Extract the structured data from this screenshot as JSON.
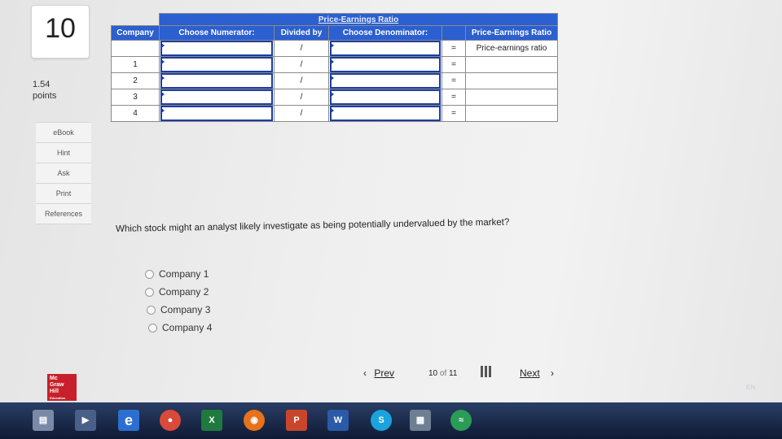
{
  "question_number": "10",
  "points": {
    "value": "1.54",
    "label": "points"
  },
  "side_tools": [
    "eBook",
    "Hint",
    "Ask",
    "Print",
    "References"
  ],
  "table": {
    "title": "Price-Earnings Ratio",
    "headers": {
      "company": "Company",
      "numerator": "Choose Numerator:",
      "divided_by": "Divided by",
      "denominator": "Choose Denominator:",
      "ratio": "Price-Earnings Ratio"
    },
    "formula_row": {
      "divide": "/",
      "equals": "=",
      "result": "Price-earnings ratio"
    },
    "rows": [
      {
        "company": "1",
        "divide": "/",
        "equals": "="
      },
      {
        "company": "2",
        "divide": "/",
        "equals": "="
      },
      {
        "company": "3",
        "divide": "/",
        "equals": "="
      },
      {
        "company": "4",
        "divide": "/",
        "equals": "="
      }
    ]
  },
  "question": "Which stock might an analyst likely investigate as being potentially undervalued by the market?",
  "options": [
    "Company 1",
    "Company 2",
    "Company 3",
    "Company 4"
  ],
  "logo_text": [
    "Mc",
    "Graw",
    "Hill",
    "Education"
  ],
  "navigation": {
    "prev": "Prev",
    "current": "10",
    "of": "of",
    "total": "11",
    "next": "Next"
  },
  "taskbar": {
    "apps": [
      "file-explorer-icon",
      "media-player-icon",
      "edge-icon",
      "chrome-icon",
      "excel-icon",
      "firefox-icon",
      "powerpoint-icon",
      "word-icon",
      "skype-icon",
      "calculator-icon",
      "wifi-icon"
    ],
    "lang": "EN"
  }
}
